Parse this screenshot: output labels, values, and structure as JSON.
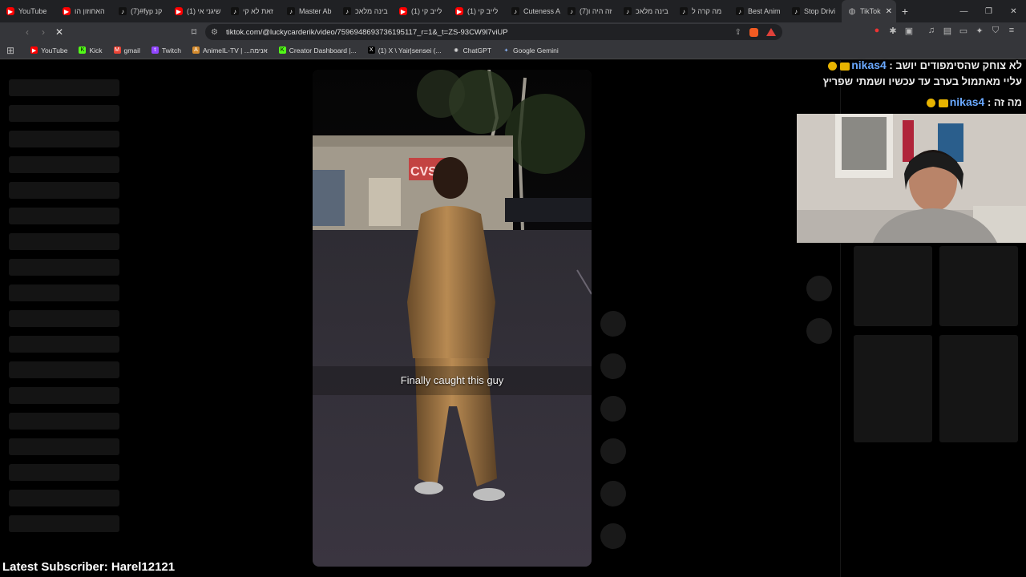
{
  "browser": {
    "tabs": [
      {
        "label": "YouTube",
        "icon": "youtube-icon"
      },
      {
        "label": "האחוזון הו",
        "icon": "youtube-icon"
      },
      {
        "label": "(7)#fyp קנ",
        "icon": "tiktok-icon"
      },
      {
        "label": "(1) שיגני אי",
        "icon": "youtube-icon"
      },
      {
        "label": "זאת לא קי",
        "icon": "tiktok-icon"
      },
      {
        "label": "Master Ab",
        "icon": "tiktok-icon"
      },
      {
        "label": "בינה מלאכ",
        "icon": "tiktok-icon"
      },
      {
        "label": "(1) לייב קי",
        "icon": "youtube-icon"
      },
      {
        "label": "(1) לייב קי",
        "icon": "youtube-icon"
      },
      {
        "label": "Cuteness A",
        "icon": "tiktok-icon"
      },
      {
        "label": "(7)זה היה ו",
        "icon": "tiktok-icon"
      },
      {
        "label": "בינה מלאכ",
        "icon": "tiktok-icon"
      },
      {
        "label": "מה קרה ל",
        "icon": "tiktok-icon"
      },
      {
        "label": "Best Anim",
        "icon": "tiktok-icon"
      },
      {
        "label": "Stop Drivi",
        "icon": "tiktok-icon"
      },
      {
        "label": "TikTok",
        "icon": "globe-icon",
        "active": true
      }
    ],
    "url": "tiktok.com/@luckycarderik/video/7596948693736195117_r=1&_t=ZS-93CW9l7viUP",
    "bookmarks": [
      {
        "label": "YouTube",
        "icon": "youtube-icon",
        "color": "#ff0000"
      },
      {
        "label": "Kick",
        "icon": "kick-icon",
        "color": "#53fc18"
      },
      {
        "label": "gmail",
        "icon": "gmail-icon",
        "color": "#ea4335"
      },
      {
        "label": "Twitch",
        "icon": "twitch-icon",
        "color": "#9146ff"
      },
      {
        "label": "AnimeIL-TV | ...אנימה",
        "icon": "animeil-icon",
        "color": "#d48b2e"
      },
      {
        "label": "Creator Dashboard |...",
        "icon": "kick-icon",
        "color": "#53fc18"
      },
      {
        "label": "(1) X \\ Yair|sensei (...",
        "icon": "x-icon",
        "color": "#000000"
      },
      {
        "label": "ChatGPT",
        "icon": "chatgpt-icon",
        "color": "#dddddd"
      },
      {
        "label": "Google Gemini",
        "icon": "gemini-icon",
        "color": "#8ab4f8"
      }
    ]
  },
  "video": {
    "caption": "Finally caught this guy"
  },
  "chat": {
    "messages": [
      {
        "user": "nikas4",
        "text": "לא צוחק שהסימפודים יושב : ",
        "cont": "עליי מאתמול בערב עד עכשיו ושמתי שפריץ"
      },
      {
        "user": "nikas4",
        "text": "מה זה : "
      }
    ]
  },
  "overlay": {
    "latest_subscriber": "Latest Subscriber: Harel12121"
  }
}
